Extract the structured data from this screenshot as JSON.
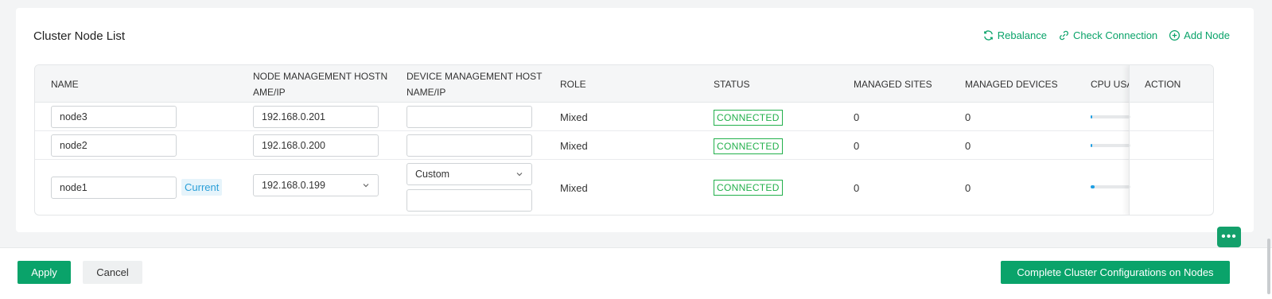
{
  "card": {
    "title": "Cluster Node List"
  },
  "toolbar": {
    "rebalance": "Rebalance",
    "check_connection": "Check Connection",
    "add_node": "Add Node"
  },
  "table": {
    "headers": {
      "name": "NAME",
      "node_mgmt_1": "NODE MANAGEMENT HOSTN",
      "node_mgmt_2": "AME/IP",
      "device_mgmt_1": "DEVICE MANAGEMENT HOST",
      "device_mgmt_2": "NAME/IP",
      "role": "ROLE",
      "status": "STATUS",
      "managed_sites": "MANAGED SITES",
      "managed_devices": "MANAGED DEVICES",
      "cpu_usage": "CPU USA",
      "action": "ACTION"
    },
    "rows": [
      {
        "name": "node3",
        "node_ip": "192.168.0.201",
        "device_host": "",
        "role": "Mixed",
        "status": "CONNECTED",
        "managed_sites": "0",
        "managed_devices": "0",
        "cpu_fraction": 0.02
      },
      {
        "name": "node2",
        "node_ip": "192.168.0.200",
        "device_host": "",
        "role": "Mixed",
        "status": "CONNECTED",
        "managed_sites": "0",
        "managed_devices": "0",
        "cpu_fraction": 0.03
      },
      {
        "name": "node1",
        "tag": "Current",
        "node_ip": "192.168.0.199",
        "device_mode": "Custom",
        "device_host": "",
        "role": "Mixed",
        "status": "CONNECTED",
        "managed_sites": "0",
        "managed_devices": "0",
        "cpu_fraction": 0.1
      }
    ]
  },
  "footer": {
    "apply": "Apply",
    "cancel": "Cancel",
    "complete": "Complete Cluster Configurations on Nodes"
  },
  "colors": {
    "brand": "#0aa36a",
    "status_connected": "#22b04b",
    "cpu_fill": "#1f9fe3",
    "tag_current": "#2a9fd8"
  },
  "icons": [
    "refresh-icon",
    "link-icon",
    "plus-circle-icon",
    "chevron-down-icon",
    "chat-icon"
  ]
}
